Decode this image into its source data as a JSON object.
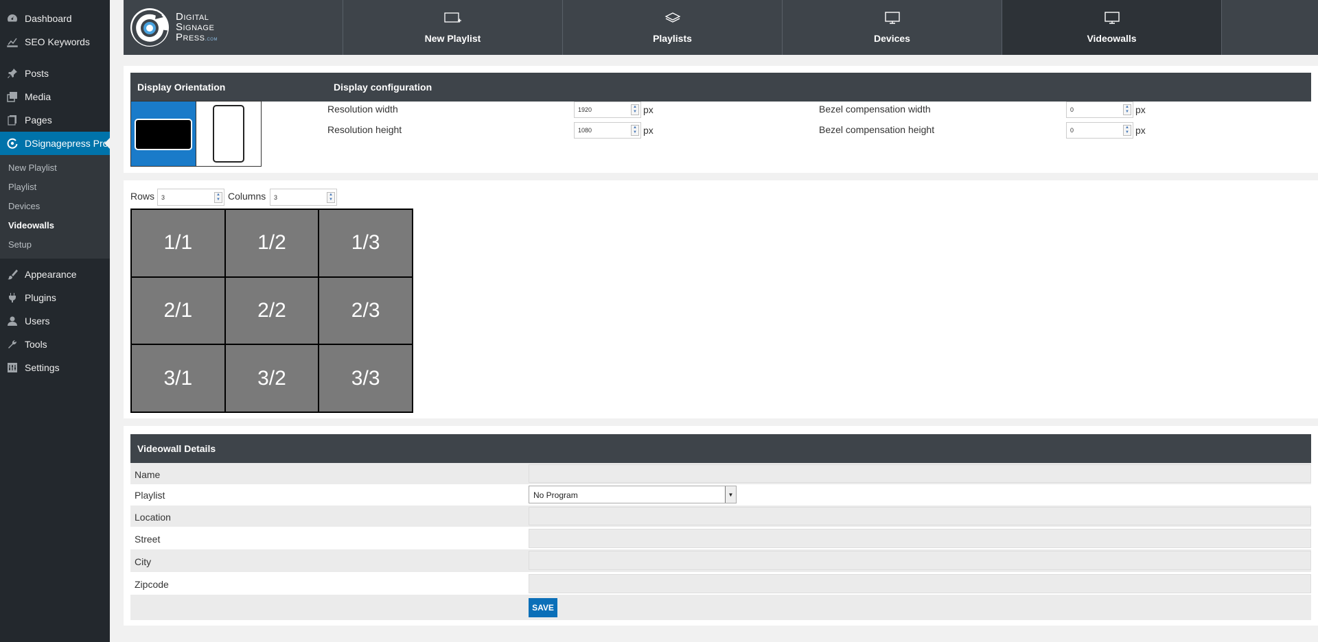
{
  "sidebar": {
    "items_top": [
      {
        "label": "Dashboard",
        "icon": "dashboard-icon"
      },
      {
        "label": "SEO Keywords",
        "icon": "seo-icon"
      }
    ],
    "items_mid": [
      {
        "label": "Posts",
        "icon": "pin-icon"
      },
      {
        "label": "Media",
        "icon": "media-icon"
      },
      {
        "label": "Pages",
        "icon": "pages-icon"
      }
    ],
    "active": {
      "label": "DSignagepress Pro",
      "icon": "dsp-icon"
    },
    "submenu": [
      "New Playlist",
      "Playlist",
      "Devices",
      "Videowalls",
      "Setup"
    ],
    "submenu_current": "Videowalls",
    "items_bottom": [
      {
        "label": "Appearance",
        "icon": "brush-icon"
      },
      {
        "label": "Plugins",
        "icon": "plug-icon"
      },
      {
        "label": "Users",
        "icon": "user-icon"
      },
      {
        "label": "Tools",
        "icon": "wrench-icon"
      },
      {
        "label": "Settings",
        "icon": "settings-icon"
      }
    ]
  },
  "logo": {
    "line1": "Digital",
    "line2": "Signage",
    "line3": "Press",
    "suffix": ".com"
  },
  "topnav": {
    "new_playlist": "New Playlist",
    "playlists": "Playlists",
    "devices": "Devices",
    "videowalls": "Videowalls",
    "active": "Videowalls"
  },
  "display": {
    "orientation_title": "Display Orientation",
    "config_title": "Display configuration",
    "orientation_selected": "landscape",
    "resolution_width_label": "Resolution width",
    "resolution_width": "1920",
    "resolution_height_label": "Resolution height",
    "resolution_height": "1080",
    "bezel_width_label": "Bezel compensation width",
    "bezel_width": "0",
    "bezel_height_label": "Bezel compensation height",
    "bezel_height": "0",
    "unit": "px"
  },
  "layout": {
    "rows_label": "Rows",
    "rows": "3",
    "columns_label": "Columns",
    "columns": "3",
    "cells": [
      "1/1",
      "1/2",
      "1/3",
      "2/1",
      "2/2",
      "2/3",
      "3/1",
      "3/2",
      "3/3"
    ]
  },
  "details": {
    "title": "Videowall Details",
    "name_label": "Name",
    "playlist_label": "Playlist",
    "playlist_value": "No Program",
    "location_label": "Location",
    "street_label": "Street",
    "city_label": "City",
    "zipcode_label": "Zipcode",
    "save_label": "SAVE"
  },
  "colors": {
    "sidebar": "#23282d",
    "accent": "#0073aa",
    "header": "#3e444a",
    "cell": "#7a7a7a"
  }
}
